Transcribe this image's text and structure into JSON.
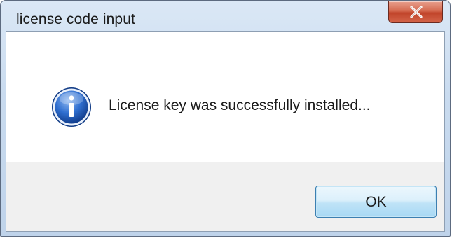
{
  "window": {
    "title": "license code input",
    "close_icon": "close-icon"
  },
  "dialog": {
    "icon": "info-icon",
    "message": "License key was successfully installed..."
  },
  "buttons": {
    "ok_label": "OK"
  },
  "colors": {
    "close_button": "#c9472d",
    "ok_button_border": "#3c7fb1",
    "info_icon": "#1f5fbf",
    "footer_background": "#f0f0f0"
  }
}
